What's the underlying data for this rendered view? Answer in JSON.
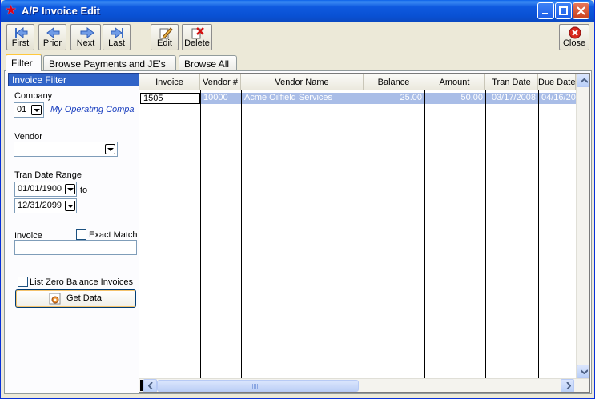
{
  "window": {
    "title": "A/P Invoice Edit"
  },
  "toolbar": {
    "first": "First",
    "prior": "Prior",
    "next": "Next",
    "last": "Last",
    "edit": "Edit",
    "delete": "Delete",
    "close": "Close"
  },
  "tabs": [
    {
      "label": "Filter",
      "active": true
    },
    {
      "label": "Browse Payments and JE's",
      "active": false
    },
    {
      "label": "Browse All",
      "active": false
    }
  ],
  "filter": {
    "header": "Invoice Filter",
    "company_label": "Company",
    "company_code": "01",
    "company_name": "My Operating Compa",
    "vendor_label": "Vendor",
    "vendor_value": "",
    "date_range_label": "Tran Date Range",
    "date_from": "01/01/1900",
    "to_label": "to",
    "date_to": "12/31/2099",
    "invoice_label": "Invoice",
    "invoice_value": "",
    "exact_match_label": "Exact Match",
    "exact_match_checked": false,
    "zero_balance_label": "List Zero Balance Invoices",
    "zero_balance_checked": false,
    "get_data_label": "Get Data"
  },
  "grid": {
    "columns": [
      "Invoice",
      "Vendor #",
      "Vendor Name",
      "Balance",
      "Amount",
      "Tran Date",
      "Due Date"
    ],
    "rows": [
      {
        "invoice": "1505",
        "vendor_no": "10000",
        "vendor_name": "Acme Oilfield Services",
        "balance": "25.00",
        "amount": "50.00",
        "tran_date": "03/17/2008",
        "due_date": "04/16/20"
      }
    ]
  },
  "colors": {
    "title_bar": "#0a5fe8",
    "filter_header": "#3164c8",
    "selection": "#a9bde7",
    "company_link": "#1a3fbf"
  },
  "icons": {
    "title": "star-icon",
    "first": "first-arrow-icon",
    "prior": "prior-arrow-icon",
    "next": "next-arrow-icon",
    "last": "last-arrow-icon",
    "edit": "pencil-icon",
    "delete": "delete-x-icon",
    "close": "close-circle-icon",
    "get_data": "gear-icon"
  }
}
